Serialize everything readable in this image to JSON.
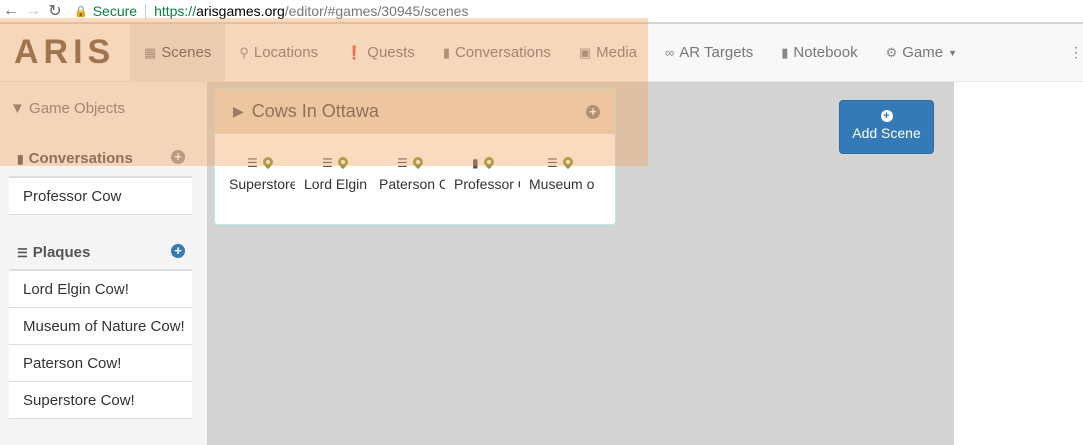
{
  "browser": {
    "secure_label": "Secure",
    "url_protocol": "https://",
    "url_host": "arisgames.org",
    "url_path": "/editor/#games/30945/scenes"
  },
  "navbar": {
    "logo": "ARIS",
    "items": [
      {
        "label": "Scenes",
        "icon": "film-icon",
        "active": true
      },
      {
        "label": "Locations",
        "icon": "map-marker-icon"
      },
      {
        "label": "Quests",
        "icon": "exclamation-circle-icon"
      },
      {
        "label": "Conversations",
        "icon": "comment-icon"
      },
      {
        "label": "Media",
        "icon": "picture-icon"
      },
      {
        "label": "AR Targets",
        "icon": "glasses-icon"
      },
      {
        "label": "Notebook",
        "icon": "book-icon"
      },
      {
        "label": "Game",
        "icon": "gear-icon",
        "dropdown": true
      }
    ]
  },
  "sidebar": {
    "title": "Game Objects",
    "sections": [
      {
        "title": "Conversations",
        "icon": "comment-icon",
        "items": [
          "Professor Cow"
        ]
      },
      {
        "title": "Plaques",
        "icon": "list-icon",
        "items": [
          "Lord Elgin Cow!",
          "Museum of Nature Cow!",
          "Paterson Cow!",
          "Superstore Cow!"
        ]
      }
    ]
  },
  "scene": {
    "title": "Cows In Ottawa",
    "objects": [
      {
        "label": "Superstore Cow!",
        "type_icon": "list-icon"
      },
      {
        "label": "Lord Elgin Cow!",
        "type_icon": "list-icon"
      },
      {
        "label": "Paterson Cow!",
        "type_icon": "list-icon"
      },
      {
        "label": "Professor Cow",
        "type_icon": "comment-icon"
      },
      {
        "label": "Museum of Nature Cow!",
        "type_icon": "list-icon"
      }
    ]
  },
  "add_scene_label": "Add Scene",
  "colors": {
    "primary": "#337ab7",
    "highlight": "#f5a05a",
    "pin": "#8a9a3a"
  }
}
